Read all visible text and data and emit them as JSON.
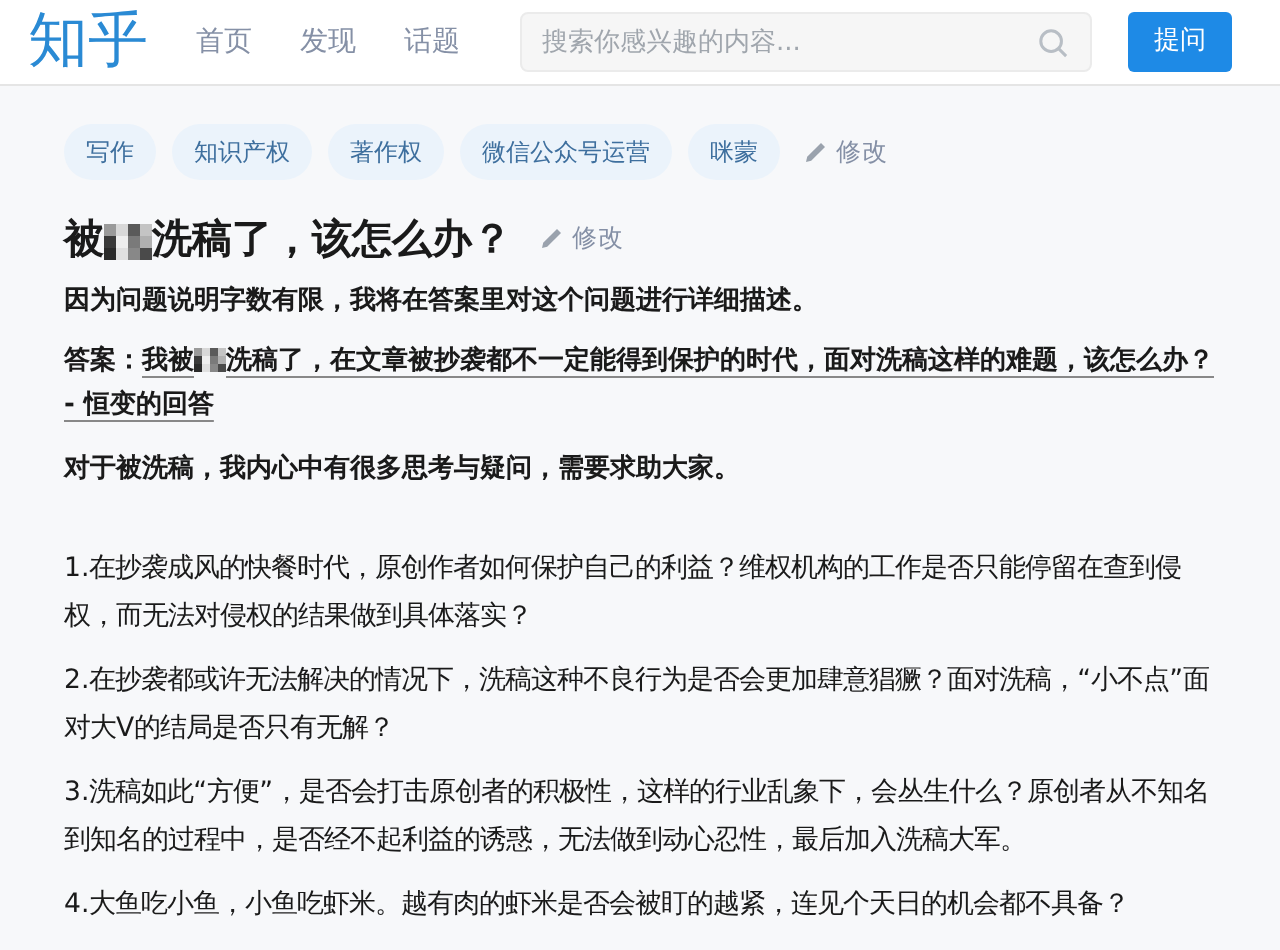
{
  "header": {
    "logo": "知乎",
    "nav": [
      {
        "label": "首页"
      },
      {
        "label": "发现"
      },
      {
        "label": "话题"
      }
    ],
    "search": {
      "placeholder": "搜索你感兴趣的内容..."
    },
    "ask_button": "提问"
  },
  "topics": [
    "写作",
    "知识产权",
    "著作权",
    "微信公众号运营",
    "咪蒙"
  ],
  "topics_edit": "修改",
  "question": {
    "title_before": "被",
    "title_after": "洗稿了，该怎么办？",
    "edit": "修改",
    "note": "因为问题说明字数有限，我将在答案里对这个问题进行详细描述。",
    "answer_label": "答案：",
    "answer_link_before": "我被",
    "answer_link_after": "洗稿了，在文章被抄袭都不一定能得到保护的时代，面对洗稿这样的难题，该怎么办？ - 恒变的回答",
    "intro": "对于被洗稿，我内心中有很多思考与疑问，需要求助大家。"
  },
  "points": [
    "1.在抄袭成风的快餐时代，原创作者如何保护自己的利益？维权机构的工作是否只能停留在查到侵权，而无法对侵权的结果做到具体落实？",
    "2.在抄袭都或许无法解决的情况下，洗稿这种不良行为是否会更加肆意猖獗？面对洗稿，“小不点”面对大V的结局是否只有无解？",
    "3.洗稿如此“方便”，是否会打击原创者的积极性，这样的行业乱象下，会丛生什么？原创者从不知名到知名的过程中，是否经不起利益的诱惑，无法做到动心忍性，最后加入洗稿大军。",
    "4.大鱼吃小鱼，小鱼吃虾米。越有肉的虾米是否会被盯的越紧，连见个天日的机会都不具备？"
  ]
}
